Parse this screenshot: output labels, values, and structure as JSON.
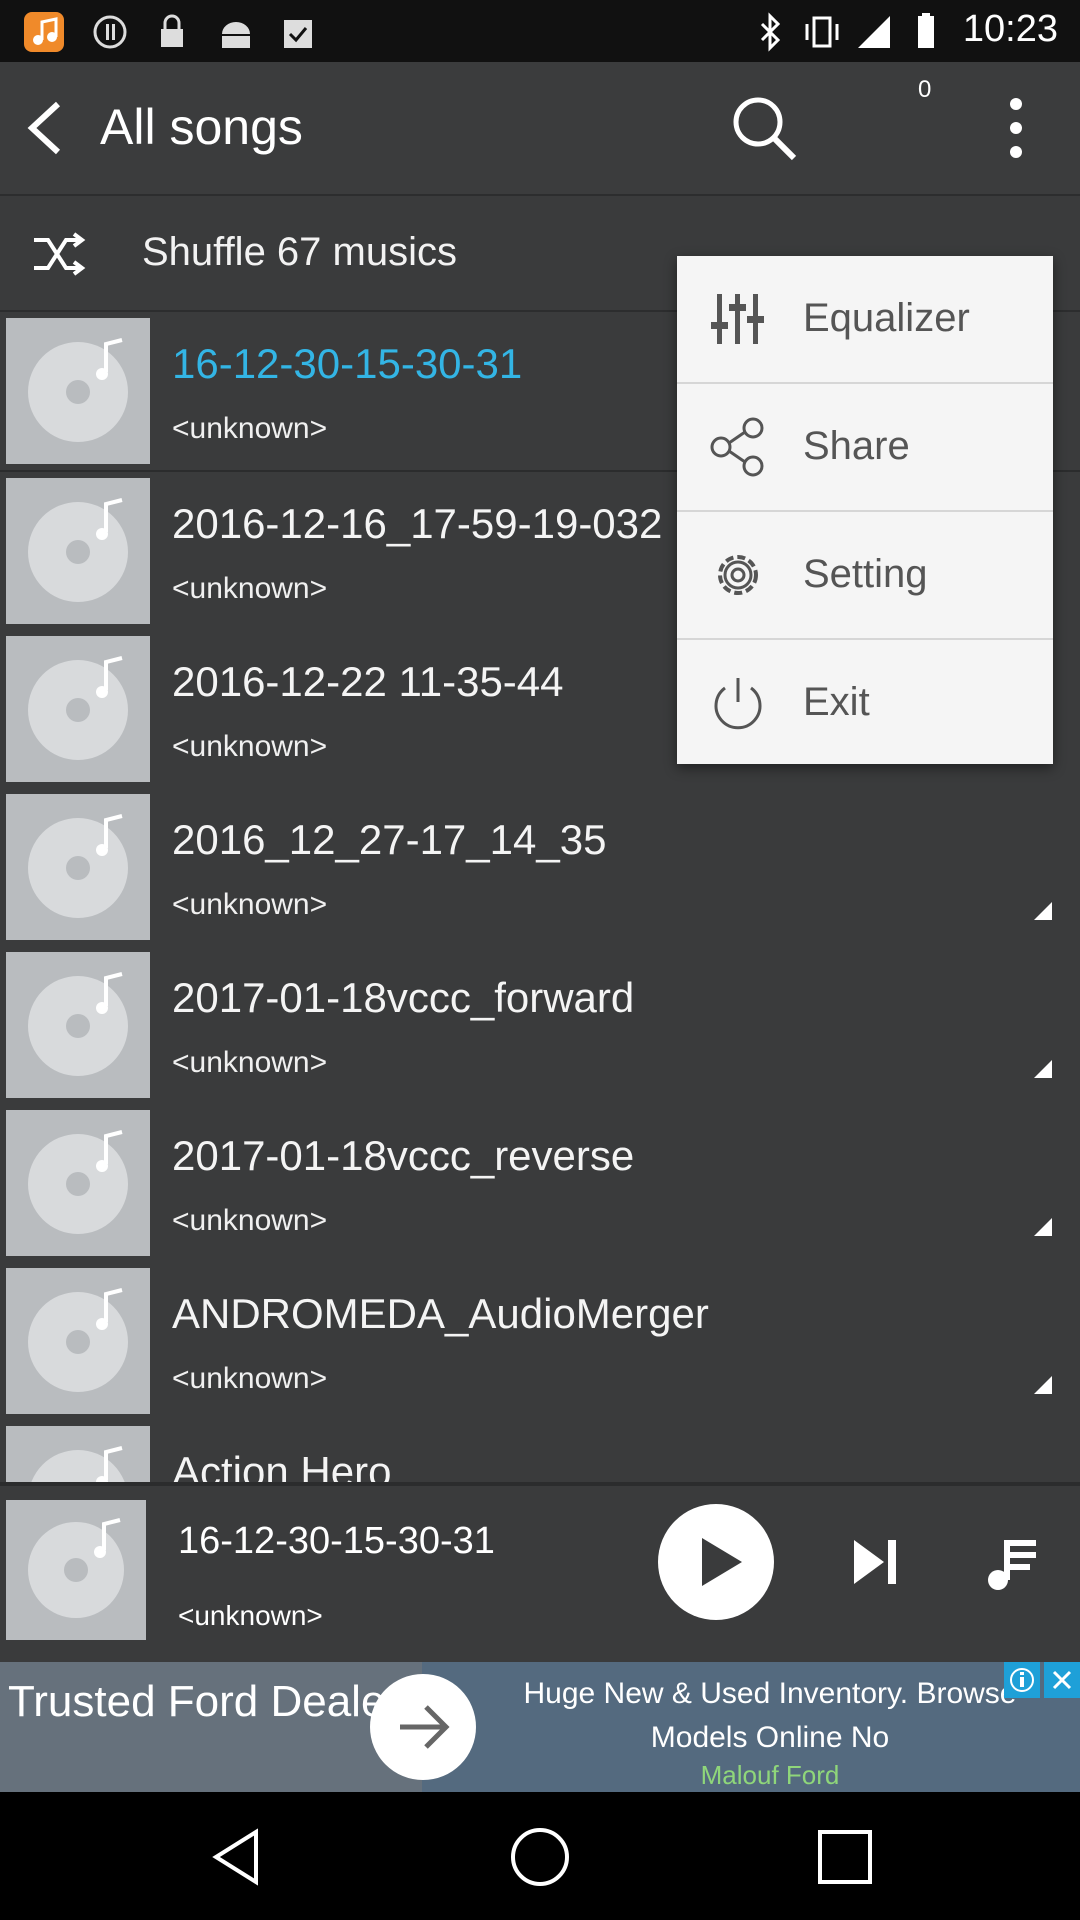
{
  "status_bar": {
    "time": "10:23"
  },
  "toolbar": {
    "title": "All songs",
    "badge": "0"
  },
  "shuffle": {
    "label": "Shuffle 67 musics"
  },
  "songs": [
    {
      "title": "16-12-30-15-30-31",
      "artist": "<unknown>"
    },
    {
      "title": "2016-12-16_17-59-19-032",
      "artist": "<unknown>"
    },
    {
      "title": "2016-12-22 11-35-44",
      "artist": "<unknown>"
    },
    {
      "title": "2016_12_27-17_14_35",
      "artist": "<unknown>"
    },
    {
      "title": "2017-01-18vccc_forward",
      "artist": "<unknown>"
    },
    {
      "title": "2017-01-18vccc_reverse",
      "artist": "<unknown>"
    },
    {
      "title": "ANDROMEDA_AudioMerger",
      "artist": "<unknown>"
    },
    {
      "title": "Action Hero",
      "artist": ""
    }
  ],
  "menu": {
    "items": [
      "Equalizer",
      "Share",
      "Setting",
      "Exit"
    ]
  },
  "player": {
    "title": "16-12-30-15-30-31",
    "artist": "<unknown>"
  },
  "ad": {
    "title": "Trusted Ford Dealer",
    "text": "Huge New & Used Inventory. Browse Models Online No",
    "brand": "Malouf Ford"
  },
  "colors": {
    "accent": "#33b5e5",
    "background": "#3a3b3c",
    "menu": "#f5f5f5"
  }
}
